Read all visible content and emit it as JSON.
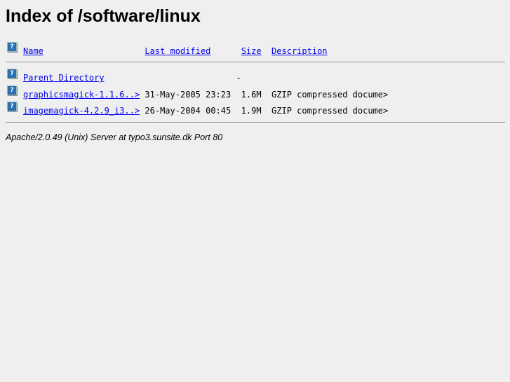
{
  "title": "Index of /software/linux",
  "header": {
    "name": "Name",
    "modified": "Last modified",
    "size": "Size",
    "description": "Description"
  },
  "rows": [
    {
      "name": "Parent Directory",
      "modified": "",
      "size": "-",
      "description": ""
    },
    {
      "name": "graphicsmagick-1.1.6..>",
      "modified": "31-May-2005 23:23",
      "size": "1.6M",
      "description": "GZIP compressed docume>"
    },
    {
      "name": "imagemagick-4.2.9_i3..>",
      "modified": "26-May-2004 00:45",
      "size": "1.9M",
      "description": "GZIP compressed docume>"
    }
  ],
  "icon_label": "?",
  "footer": "Apache/2.0.49 (Unix) Server at typo3.sunsite.dk Port 80"
}
